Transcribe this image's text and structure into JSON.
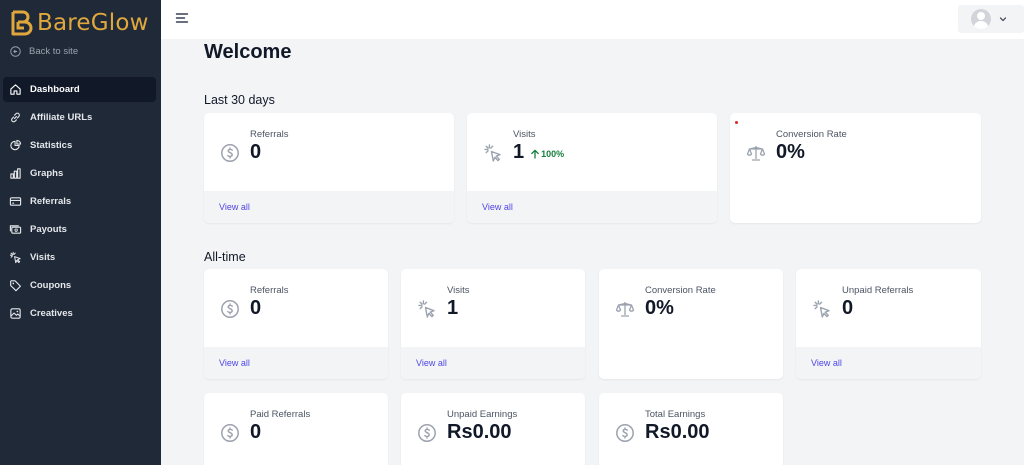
{
  "app": {
    "brand": "BareGlow",
    "back_label": "Back to site"
  },
  "nav": {
    "items": [
      {
        "label": "Dashboard",
        "icon": "home-icon",
        "active": true
      },
      {
        "label": "Affiliate URLs",
        "icon": "link-icon"
      },
      {
        "label": "Statistics",
        "icon": "pie-chart-icon"
      },
      {
        "label": "Graphs",
        "icon": "bar-chart-icon"
      },
      {
        "label": "Referrals",
        "icon": "credit-card-icon"
      },
      {
        "label": "Payouts",
        "icon": "cash-icon"
      },
      {
        "label": "Visits",
        "icon": "cursor-click-icon"
      },
      {
        "label": "Coupons",
        "icon": "tag-icon"
      },
      {
        "label": "Creatives",
        "icon": "image-icon"
      }
    ]
  },
  "page": {
    "title": "Welcome"
  },
  "last30": {
    "heading": "Last 30 days",
    "referrals": {
      "label": "Referrals",
      "value": "0",
      "link": "View all"
    },
    "visits": {
      "label": "Visits",
      "value": "1",
      "trend": "100%",
      "link": "View all"
    },
    "conversion": {
      "label": "Conversion Rate",
      "value": "0%"
    }
  },
  "alltime": {
    "heading": "All-time",
    "referrals": {
      "label": "Referrals",
      "value": "0",
      "link": "View all"
    },
    "visits": {
      "label": "Visits",
      "value": "1",
      "link": "View all"
    },
    "conversion": {
      "label": "Conversion Rate",
      "value": "0%"
    },
    "unpaid_referrals": {
      "label": "Unpaid Referrals",
      "value": "0",
      "link": "View all"
    },
    "paid_referrals": {
      "label": "Paid Referrals",
      "value": "0"
    },
    "unpaid_earnings": {
      "label": "Unpaid Earnings",
      "value": "Rs0.00"
    },
    "total_earnings": {
      "label": "Total Earnings",
      "value": "Rs0.00"
    }
  },
  "colors": {
    "sidebar": "#1f2937",
    "brand": "#e0a83c",
    "link": "#4f46e5",
    "trend_up": "#15803d"
  }
}
